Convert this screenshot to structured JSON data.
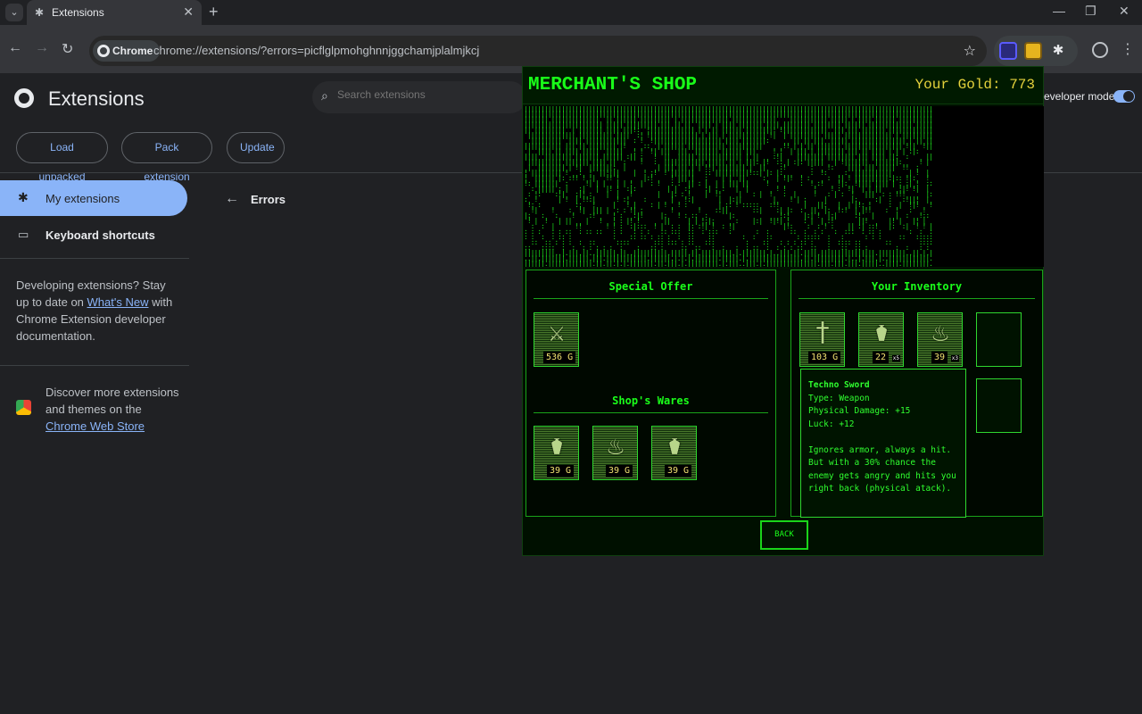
{
  "browser": {
    "tab_title": "Extensions",
    "chip_label": "Chrome",
    "url": "chrome://extensions/?errors=picflglpmohghnnjggchamjplalmjkcj"
  },
  "extensions_page": {
    "title": "Extensions",
    "search_placeholder": "Search extensions",
    "dev_mode_label": "eveloper mode",
    "buttons": {
      "load_unpacked": "Load unpacked",
      "pack_extension": "Pack extension",
      "update": "Update"
    },
    "sidebar": {
      "my_extensions": "My extensions",
      "keyboard_shortcuts": "Keyboard shortcuts",
      "dev_text_before": "Developing extensions? Stay up to date on ",
      "dev_link": "What's New",
      "dev_text_after": " with Chrome Extension developer documentation.",
      "store_text_before": "Discover more extensions and themes on the ",
      "store_link": "Chrome Web Store"
    },
    "errors_title": "Errors"
  },
  "shop": {
    "title": "MERCHANT'S SHOP",
    "gold_label": "Your Gold: 773",
    "special_offer": {
      "title": "Special Offer",
      "items": [
        {
          "icon": "sword-icon",
          "price": "536 G"
        }
      ]
    },
    "wares": {
      "title": "Shop's Wares",
      "items": [
        {
          "icon": "potion-icon",
          "price": "39 G"
        },
        {
          "icon": "fire-potion-icon",
          "price": "39 G"
        },
        {
          "icon": "potion-icon",
          "price": "39 G"
        }
      ]
    },
    "inventory": {
      "title": "Your Inventory",
      "items": [
        {
          "icon": "sword-icon",
          "price": "103 G",
          "qty": ""
        },
        {
          "icon": "potion-icon",
          "price": "22",
          "qty": "x5"
        },
        {
          "icon": "fire-potion-icon",
          "price": "39",
          "qty": "x3"
        }
      ]
    },
    "tooltip": {
      "name": "Techno Sword",
      "type": "Type: Weapon",
      "damage": "Physical Damage: +15",
      "luck": "Luck: +12",
      "description": "Ignores armor, always a hit. But with a 30% chance the enemy gets angry and hits you right back (physical atack)."
    },
    "back_label": "BACK"
  },
  "colors": {
    "accent_green": "#1aff1a",
    "gold": "#e6d23c",
    "chrome_blue": "#8ab4f8"
  }
}
